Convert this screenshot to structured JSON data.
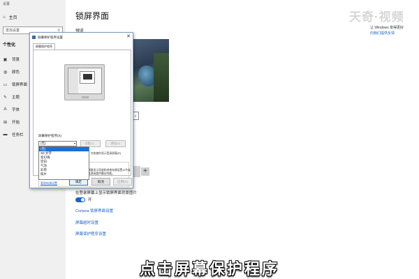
{
  "app": {
    "title": "设置"
  },
  "sidebar": {
    "home": {
      "icon": "home-icon",
      "label": "主页"
    },
    "search": {
      "placeholder": "查找设置",
      "icon": "search-icon"
    },
    "section": "个性化",
    "items": [
      {
        "icon": "background-icon",
        "label": "背景"
      },
      {
        "icon": "palette-icon",
        "label": "颜色"
      },
      {
        "icon": "lock-screen-icon",
        "label": "锁屏界面"
      },
      {
        "icon": "theme-icon",
        "label": "主题"
      },
      {
        "icon": "font-icon",
        "label": "字体"
      },
      {
        "icon": "start-icon",
        "label": "开始"
      },
      {
        "icon": "taskbar-icon",
        "label": "任务栏"
      }
    ]
  },
  "main": {
    "title": "锁屏界面",
    "preview_label": "预览",
    "right_info": {
      "line1": "让 Windows 变得更好",
      "link": "向我们提供反馈"
    },
    "show_bg_label": "在登录屏幕上显示锁屏界面背景图片",
    "toggle": {
      "state": "on",
      "label": "开"
    },
    "links": {
      "cortana": "Cortana 锁屏界面设置",
      "timeout": "屏幕超时设置",
      "screensaver": "屏幕保护程序设置"
    }
  },
  "dialog": {
    "title": "屏幕保护程序设置",
    "tab": "屏幕保护程序",
    "screensaver_label": "屏幕保护程序(S)",
    "selected": "(无)",
    "settings_btn": "设置(T)...",
    "preview_btn": "预览(V)",
    "options": [
      "(无)",
      "3D 文字",
      "变幻线",
      "空白",
      "气泡",
      "彩带",
      "照片"
    ],
    "resume_text": "在恢复时显示登录屏幕(R)",
    "power_text": "调整显示亮度和其他电源设置以节省能源或提供最佳性能。",
    "power_link": "更改电源设置",
    "ok": "确定",
    "cancel": "取消",
    "apply": "应用(A)",
    "close_icon": "close-icon"
  },
  "watermark": "天奇·视频",
  "caption": "点击屏幕保护程序",
  "colors": {
    "accent": "#1a63c9",
    "selection": "#1c6fd6",
    "sidebar_bg": "#f0f0f0"
  }
}
